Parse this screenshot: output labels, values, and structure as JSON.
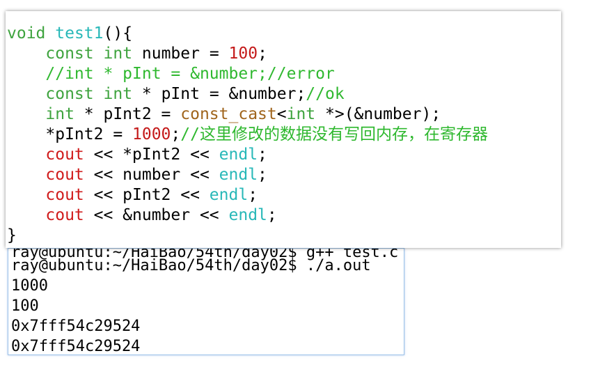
{
  "code": {
    "line1": {
      "kw": "void",
      "fn": "test1",
      "rest": "(){"
    },
    "line2": {
      "indent": "    ",
      "kw1": "const",
      "sp1": " ",
      "kw2": "int",
      "text": " number = ",
      "num": "100",
      "end": ";"
    },
    "line3": {
      "indent": "    ",
      "comment": "//int * pInt = &number;//error"
    },
    "line4": {
      "indent": "    ",
      "kw1": "const",
      "sp1": " ",
      "kw2": "int",
      "text": " * pInt = &number;",
      "comment": "//ok"
    },
    "line5": {
      "indent": "    ",
      "kw": "int",
      "text1": " * pInt2 = ",
      "cast": "const_cast",
      "text2": "<",
      "kw2": "int",
      "text3": " *>(&number);"
    },
    "line6": {
      "indent": "    ",
      "text1": "*pInt2 = ",
      "num": "1000",
      "text2": ";",
      "comment": "//这里修改的数据没有写回内存，在寄存器"
    },
    "line7": {
      "indent": "    ",
      "stream": "cout",
      "text": " << *pInt2 << ",
      "endl": "endl",
      "end": ";"
    },
    "line8": {
      "indent": "    ",
      "stream": "cout",
      "text": " << number << ",
      "endl": "endl",
      "end": ";"
    },
    "line9": {
      "indent": "    ",
      "stream": "cout",
      "text": " << pInt2 << ",
      "endl": "endl",
      "end": ";"
    },
    "line10": {
      "indent": "    ",
      "stream": "cout",
      "text": " << &number << ",
      "endl": "endl",
      "end": ";"
    },
    "line11": {
      "text": "}"
    }
  },
  "terminal": {
    "clipped": "ray@ubuntu:~/HaiBao/54th/day02$ g++ test.c",
    "prompt": "ray@ubuntu:~/HaiBao/54th/day02$ ./a.out",
    "out1": "1000",
    "out2": "100",
    "out3": "0x7fff54c29524",
    "out4": "0x7fff54c29524"
  },
  "colors": {
    "keyword": "#3ea33e",
    "function": "#28b8b8",
    "number": "#c41a1a",
    "comment": "#2fb82f",
    "stream": "#d01b1b",
    "cast": "#a0651d",
    "terminal_border": "#9ec3ea"
  }
}
